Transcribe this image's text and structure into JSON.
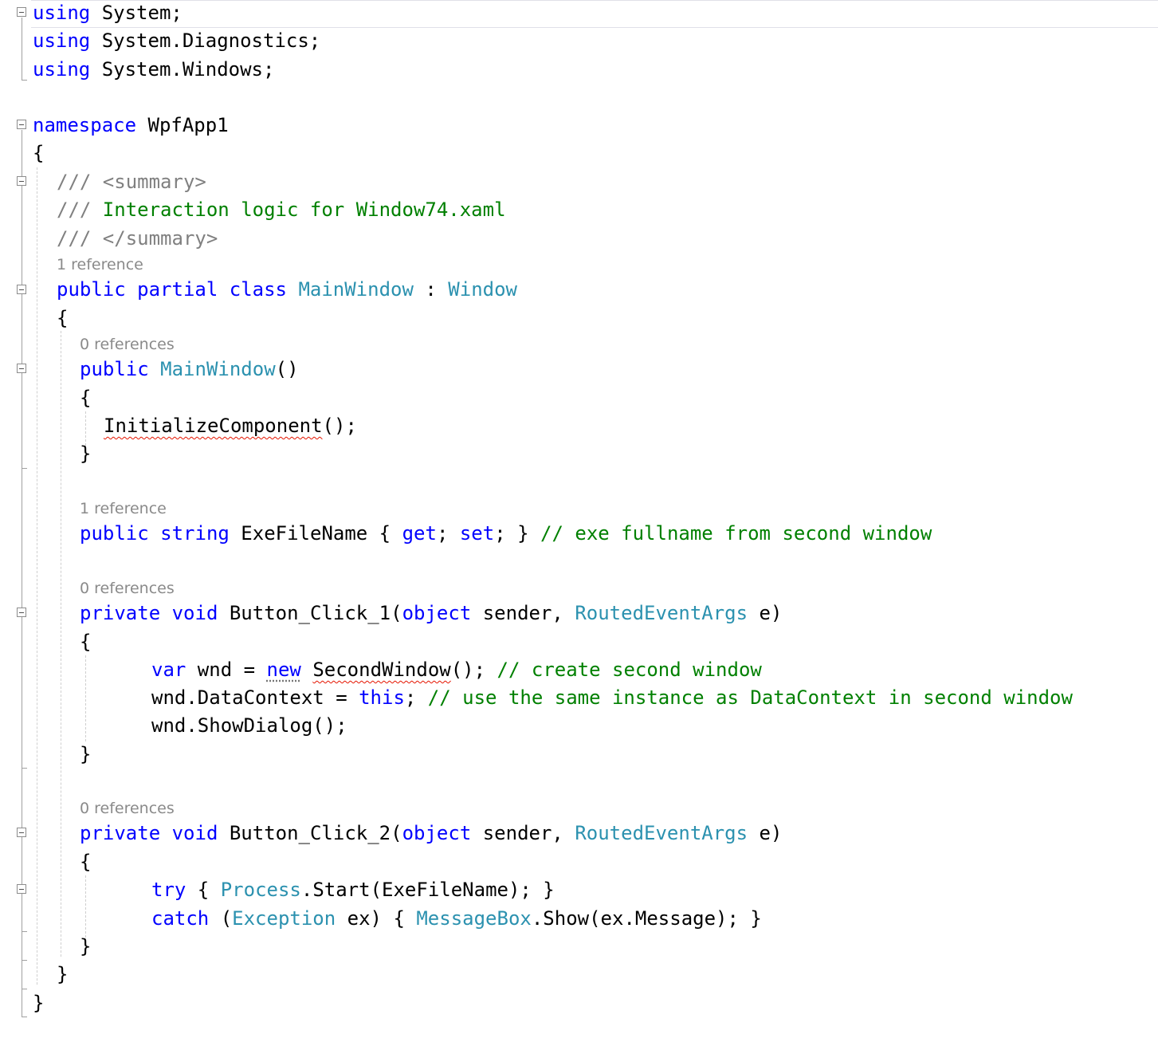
{
  "code": {
    "l1": {
      "kw": "using",
      "rest": " System;"
    },
    "l2": {
      "kw": "using",
      "rest": " System.Diagnostics;"
    },
    "l3": {
      "kw": "using",
      "rest": " System.Windows;"
    },
    "l4": {
      "kw": "namespace",
      "rest": " WpfApp1"
    },
    "l5": {
      "text": "{"
    },
    "l6": {
      "slashes": "///",
      "tag": " <summary>"
    },
    "l7": {
      "slashes": "///",
      "text": " Interaction logic for Window74.xaml"
    },
    "l8": {
      "slashes": "///",
      "tag": " </summary>"
    },
    "lens1": "1 reference",
    "l9": {
      "kw": "public partial class",
      "type1": "MainWindow",
      "colon": " : ",
      "type2": "Window"
    },
    "l10": {
      "text": "{"
    },
    "lens2": "0 references",
    "l11": {
      "kw": "public",
      "type": "MainWindow",
      "rest": "()"
    },
    "l12": {
      "text": "{"
    },
    "l13": {
      "squig": "InitializeComponent",
      "rest": "();"
    },
    "l14": {
      "text": "}"
    },
    "lens3": "1 reference",
    "l15": {
      "kw1": "public string",
      "mid1": " ExeFileName { ",
      "kw2": "get",
      "mid2": "; ",
      "kw3": "set",
      "mid3": "; } ",
      "comment": "// exe fullname from second window"
    },
    "lens4": "0 references",
    "l16": {
      "kw1": "private void",
      "mid1": " Button_Click_1(",
      "kw2": "object",
      "mid2": " sender, ",
      "type": "RoutedEventArgs",
      "rest": " e)"
    },
    "l17": {
      "text": "{"
    },
    "l18": {
      "kw1": "var",
      "mid1": " wnd = ",
      "kw2": "new",
      "squig": "SecondWindow",
      "rest": "(); ",
      "comment": "// create second window"
    },
    "l19": {
      "mid1": "wnd.DataContext = ",
      "kw": "this",
      "rest": "; ",
      "comment": "// use the same instance as DataContext in second window"
    },
    "l20": {
      "text": "wnd.ShowDialog();"
    },
    "l21": {
      "text": "}"
    },
    "lens5": "0 references",
    "l22": {
      "kw1": "private void",
      "mid1": " Button_Click_2(",
      "kw2": "object",
      "mid2": " sender, ",
      "type": "RoutedEventArgs",
      "rest": " e)"
    },
    "l23": {
      "text": "{"
    },
    "l24": {
      "kw": "try",
      "mid1": " { ",
      "type": "Process",
      "rest": ".Start(ExeFileName); }"
    },
    "l25": {
      "kw": "catch",
      "mid1": " (",
      "type1": "Exception",
      "mid2": " ex) { ",
      "type2": "MessageBox",
      "rest": ".Show(ex.Message); }"
    },
    "l26": {
      "text": "}"
    },
    "l27": {
      "text": "}"
    },
    "l28": {
      "text": "}"
    }
  },
  "colors": {
    "keyword": "#0000ff",
    "type": "#2b91af",
    "comment": "#008000",
    "doc_comment": "#808080",
    "error_squiggle": "#e51400"
  }
}
